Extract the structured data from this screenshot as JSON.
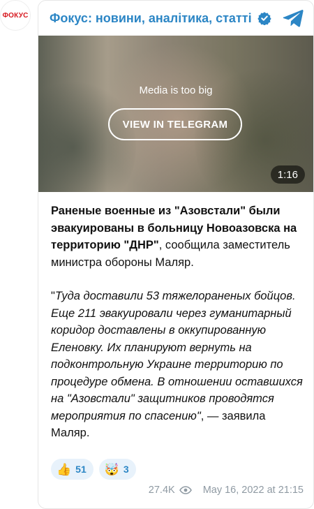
{
  "channel": {
    "avatar_text": "ФОКУС",
    "title": "Фокус: новини, аналітика, статті",
    "verified_icon": "verified-check-icon",
    "telegram_icon": "telegram-icon"
  },
  "media": {
    "message": "Media is too big",
    "button_label": "VIEW IN TELEGRAM",
    "duration": "1:16"
  },
  "post": {
    "bold_part": "Раненые военные из \"Азовстали\" были эвакуированы в больницу Новоазовска на территорию \"ДНР\"",
    "normal_part": ", сообщила заместитель министра обороны Маляр.",
    "quote_open": "\"",
    "quote_italic": "Туда доставили 53 тяжелораненых бойцов. Еще 211 эвакуировали через гуманитарный коридор доставлены в оккупированную Еленовку. Их планируют вернуть на подконтрольную Украине территорию по процедуре обмена. В отношении оставшихся на \"Азовстали\" защитников проводятся мероприятия по спасению\"",
    "quote_tail": ", — заявила Маляр."
  },
  "reactions": [
    {
      "emoji": "👍",
      "icon": "thumbs-up-icon",
      "count": "51"
    },
    {
      "emoji": "🤯",
      "icon": "exploding-head-icon",
      "count": "3"
    }
  ],
  "footer": {
    "views": "27.4K",
    "views_icon": "eye-icon",
    "datetime": "May 16, 2022 at 21:15"
  },
  "colors": {
    "accent": "#2c86c5",
    "brand_red": "#d71920",
    "meta_gray": "#8f9aa3",
    "reaction_bg": "#e8f2fb"
  }
}
